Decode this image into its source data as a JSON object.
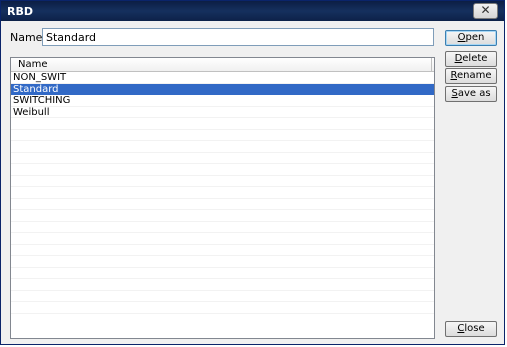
{
  "window": {
    "title": "RBD",
    "close_glyph": "✕"
  },
  "form": {
    "name_label": "Name:",
    "name_value": "Standard"
  },
  "list": {
    "header": "Name",
    "items": [
      {
        "label": "NON_SWIT",
        "selected": false
      },
      {
        "label": "Standard",
        "selected": true
      },
      {
        "label": "SWITCHING",
        "selected": false
      },
      {
        "label": "Weibull",
        "selected": false
      }
    ],
    "empty_rows": 17
  },
  "buttons": {
    "open": {
      "mnemonic": "O",
      "rest": "pen"
    },
    "delete": {
      "mnemonic": "D",
      "rest": "elete"
    },
    "rename": {
      "mnemonic": "R",
      "rest": "ename"
    },
    "save_as": {
      "mnemonic": "S",
      "rest": "ave as"
    },
    "close": {
      "mnemonic": "C",
      "rest": "lose"
    }
  },
  "colors": {
    "titlebar": "#0c1e44",
    "selection": "#3169c6"
  }
}
